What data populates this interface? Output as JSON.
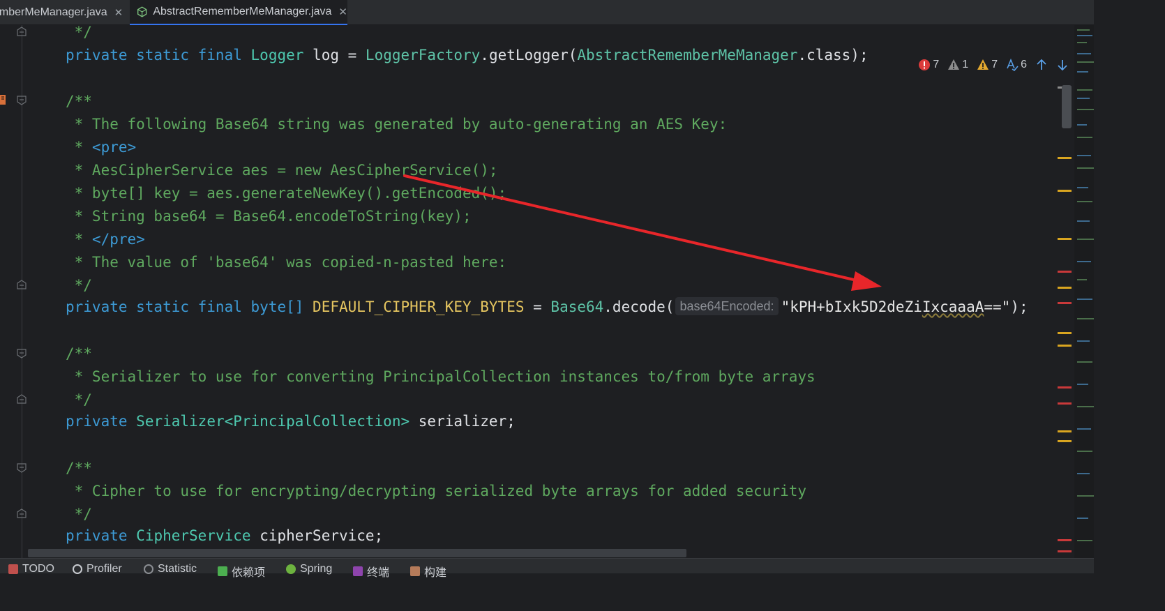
{
  "tabs": [
    {
      "label": "emberMeManager.java",
      "close": "✕"
    },
    {
      "label": "AbstractRememberMeManager.java",
      "close": "✕",
      "icon": "class-file-icon"
    }
  ],
  "inspections": {
    "errors": "7",
    "weak_warnings": "1",
    "warnings": "7",
    "typos": "6"
  },
  "code": {
    "l1": " */",
    "l2": {
      "kw": "private static final",
      "type": "Logger",
      "var": "log",
      "eq": " = ",
      "cls": "LoggerFactory",
      "call": ".getLogger(",
      "arg": "AbstractRememberMeManager",
      "tail": ".class);"
    },
    "l4": "/**",
    "l5": " * The following Base64 string was generated by auto-generating an AES Key:",
    "l6a": " * ",
    "l6b": "<pre>",
    "l7": " * AesCipherService aes = new AesCipherService();",
    "l8": " * byte[] key = aes.generateNewKey().getEncoded();",
    "l9": " * String base64 = Base64.encodeToString(key);",
    "l10a": " * ",
    "l10b": "</pre>",
    "l11": " * The value of 'base64' was copied-n-pasted here:",
    "l12": " */",
    "l13": {
      "kw": "private static final",
      "type": "byte[]",
      "field": "DEFAULT_CIPHER_KEY_BYTES",
      "eq": " = ",
      "cls": "Base64",
      "call": ".decode(",
      "hint": "base64Encoded:",
      "str_a": "\"kPH+bIxk5D2deZi",
      "str_b": "IxcaaaA",
      "str_c": "==\"",
      "tail": ");"
    },
    "l15": "/**",
    "l16": " * Serializer to use for converting PrincipalCollection instances to/from byte arrays",
    "l17": " */",
    "l18": {
      "kw": "private",
      "type": "Serializer",
      "generic": "<PrincipalCollection>",
      "var": "serializer",
      "tail": ";"
    },
    "l20": "/**",
    "l21": " * Cipher to use for encrypting/decrypting serialized byte arrays for added security",
    "l22": " */",
    "l23": {
      "kw": "private",
      "type": "CipherService",
      "var": "cipherService",
      "tail": ";"
    }
  },
  "bottom_tools": [
    {
      "label": "TODO",
      "icon": "todo-icon"
    },
    {
      "label": "Profiler",
      "icon": "profiler-icon"
    },
    {
      "label": "Statistic",
      "icon": "statistic-icon"
    },
    {
      "label": "依赖项",
      "icon": "dependencies-icon"
    },
    {
      "label": "Spring",
      "icon": "spring-icon"
    },
    {
      "label": "终端",
      "icon": "terminal-icon"
    },
    {
      "label": "构建",
      "icon": "build-icon"
    }
  ],
  "colors": {
    "keyword": "#3d9bd6",
    "comment": "#5fa95f",
    "field": "#e6c660",
    "error_marker": "#c9393a",
    "warning_marker": "#d9a520",
    "annotation_arrow": "#e8262a"
  }
}
